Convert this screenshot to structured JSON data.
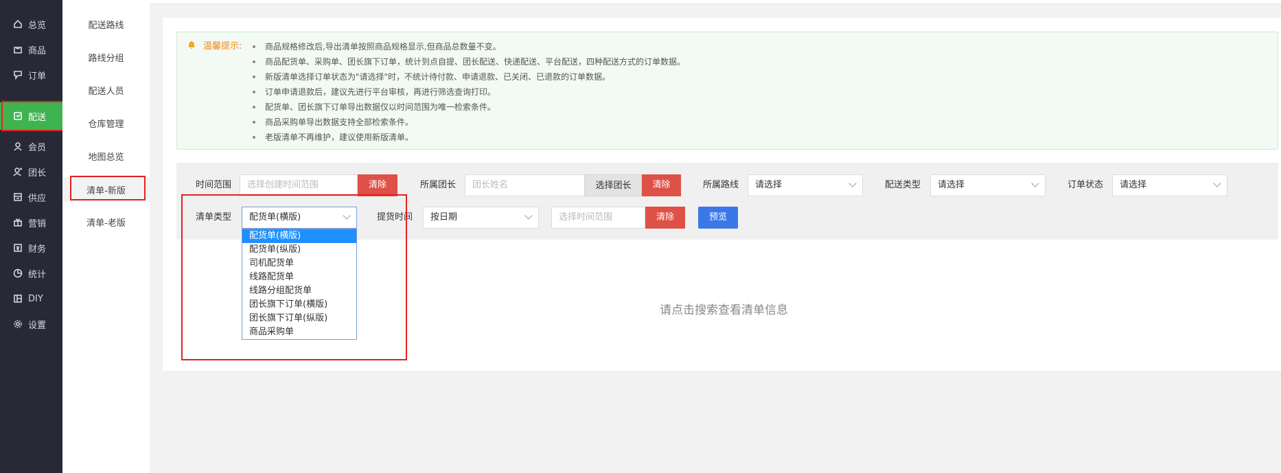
{
  "nav": [
    {
      "label": "总览",
      "icon": "home-icon"
    },
    {
      "label": "商品",
      "icon": "shopping-bag-icon"
    },
    {
      "label": "订单",
      "icon": "order-icon"
    },
    {
      "label": "配送",
      "icon": "delivery-icon",
      "active": true
    },
    {
      "label": "会员",
      "icon": "user-icon"
    },
    {
      "label": "团长",
      "icon": "leader-icon"
    },
    {
      "label": "供应",
      "icon": "supply-icon"
    },
    {
      "label": "营销",
      "icon": "gift-icon"
    },
    {
      "label": "财务",
      "icon": "finance-icon"
    },
    {
      "label": "统计",
      "icon": "pie-chart-icon"
    },
    {
      "label": "DIY",
      "icon": "layout-icon"
    },
    {
      "label": "设置",
      "icon": "gear-icon"
    }
  ],
  "submenu": [
    {
      "label": "配送路线"
    },
    {
      "label": "路线分组"
    },
    {
      "label": "配送人员"
    },
    {
      "label": "仓库管理"
    },
    {
      "label": "地图总览"
    },
    {
      "label": "清单-新版",
      "active": true
    },
    {
      "label": "清单-老版"
    }
  ],
  "tips": {
    "title": "温馨提示:",
    "items": [
      "商品规格修改后,导出清单按照商品规格显示,但商品总数量不变。",
      "商品配货单、采购单、团长旗下订单，统计到点自提、团长配送、快递配送、平台配送，四种配送方式的订单数据。",
      "新版清单选择订单状态为\"请选择\"时，不统计待付款、申请退款、已关闭、已退款的订单数据。",
      "订单申请退款后，建议先进行平台审核，再进行筛选查询打印。",
      "配货单、团长旗下订单导出数据仅以时间范围为唯一检索条件。",
      "商品采购单导出数据支持全部检索条件。",
      "老版清单不再维护，建议使用新版清单。"
    ]
  },
  "filter": {
    "time_range_label": "时间范围",
    "time_range_placeholder": "选择创建时间范围",
    "clear": "清除",
    "leader_label": "所属团长",
    "leader_placeholder": "团长姓名",
    "choose_leader": "选择团长",
    "route_label": "所属路线",
    "route_value": "请选择",
    "delivery_type_label": "配送类型",
    "delivery_type_value": "请选择",
    "order_status_label": "订单状态",
    "order_status_value": "请选择",
    "list_type_label": "清单类型",
    "list_type_value": "配货单(横版)",
    "pickup_label": "提货时间",
    "pickup_value": "按日期",
    "pickup_range_placeholder": "选择时间范围",
    "preview": "预览"
  },
  "list_type_options": [
    "配货单(横版)",
    "配货单(纵版)",
    "司机配货单",
    "线路配货单",
    "线路分组配货单",
    "团长旗下订单(横版)",
    "团长旗下订单(纵版)",
    "商品采购单"
  ],
  "empty_text": "请点击搜索查看清单信息",
  "colors": {
    "nav_bg": "#272a36",
    "nav_active": "#3fb34f",
    "danger": "#de5147",
    "primary": "#3b78e7",
    "highlight": "#e62020"
  }
}
